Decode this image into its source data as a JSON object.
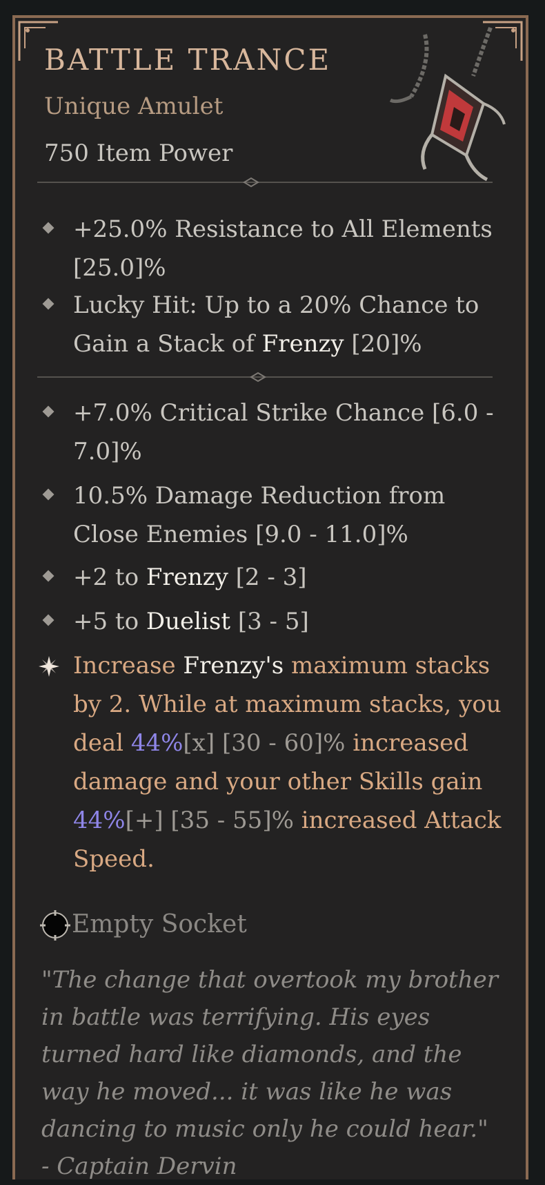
{
  "item": {
    "name": "BATTLE TRANCE",
    "rarity_type": "Unique Amulet",
    "item_power": "750 Item Power"
  },
  "implicit_affixes": [
    {
      "value": "+25.0%",
      "text": " Resistance to All Elements ",
      "range": "[25.0]%"
    },
    {
      "prefix": "Lucky Hit: Up to a 20% Chance to Gain a Stack of ",
      "keyword": "Frenzy",
      "range": " [20]%"
    }
  ],
  "affixes": [
    {
      "text": "+7.0% Critical Strike Chance ",
      "range": "[6.0 - 7.0]%"
    },
    {
      "text": "10.5% Damage Reduction from Close Enemies ",
      "range": "[9.0 - 11.0]%"
    },
    {
      "text": "+2 to ",
      "keyword": "Frenzy",
      "range": " [2 - 3]"
    },
    {
      "text": "+5 to ",
      "keyword": "Duelist",
      "range": " [3 - 5]"
    }
  ],
  "unique_power": {
    "p1": "Increase ",
    "k1": "Frenzy's",
    "p2": " maximum stacks by 2. While at maximum stacks, you deal  ",
    "v1": "44%",
    "m1": "[x]",
    "r1": " [30 - 60]%",
    "p3": " increased damage and your other Skills gain ",
    "v2": "44%",
    "m2": "[+]",
    "r2": " [35 - 55]%",
    "p4": " increased Attack Speed."
  },
  "socket": {
    "label": "Empty Socket"
  },
  "flavor": {
    "quote": "\"The change that overtook my brother in battle was terrifying. His eyes turned hard like diamonds, and the way he moved... it was like he was dancing to music only he could hear.\"",
    "author": "- Captain Dervin"
  },
  "colors": {
    "frame": "#8a6a52",
    "title": "#d8b79c",
    "unique_text": "#d9a983",
    "roll_value": "#8f86e8",
    "keyword": "#f2efe8"
  },
  "icons": [
    "amulet-icon",
    "diamond-bullet-icon",
    "unique-star-icon",
    "socket-icon",
    "frame-corner-icon"
  ]
}
